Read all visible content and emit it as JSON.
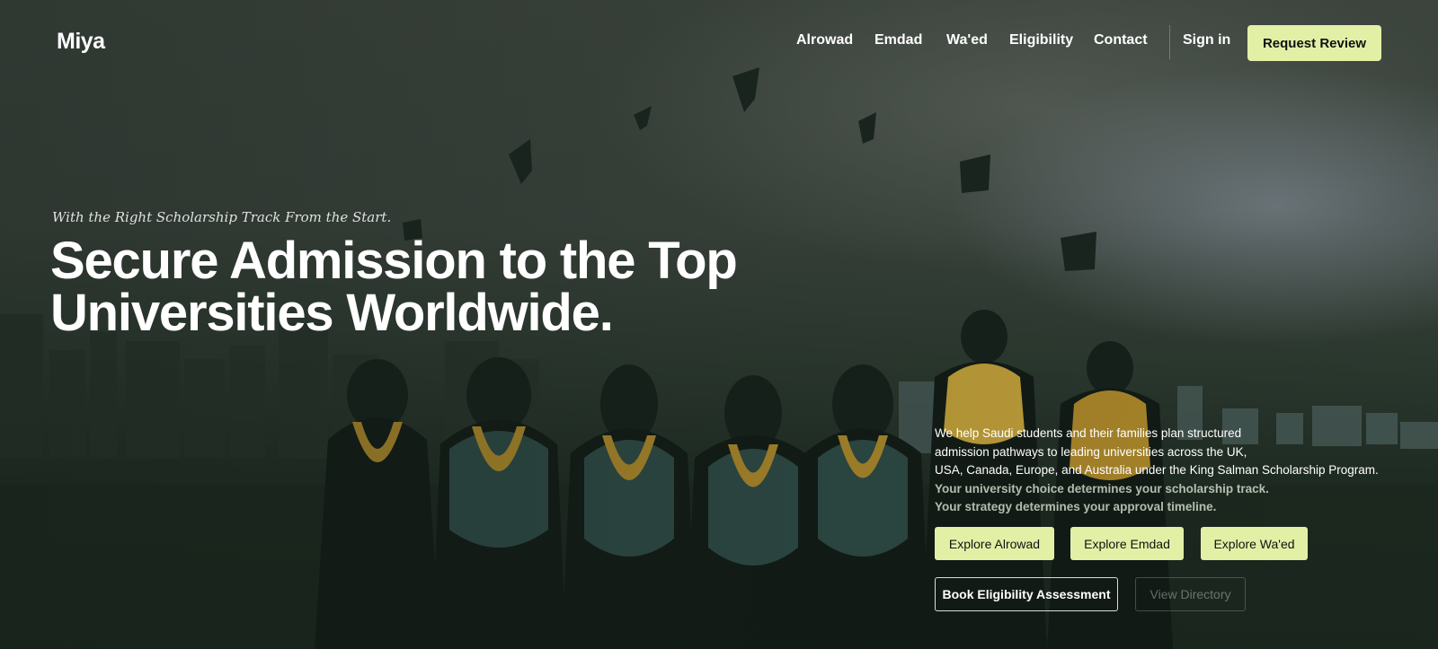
{
  "brand": {
    "logo_text": "Miya",
    "accent_color": "#e2f0a6"
  },
  "nav": {
    "items": [
      {
        "label": "Alrowad"
      },
      {
        "label": "Emdad"
      },
      {
        "label": "Wa'ed"
      },
      {
        "label": "Eligibility"
      },
      {
        "label": "Contact"
      }
    ],
    "sign_in_label": "Sign in",
    "cta_label": "Request Review"
  },
  "hero": {
    "background_image": "graduates-throwing-caps-photo",
    "tagline": "With the Right Scholarship Track From the Start.",
    "headline_line1": "Secure Admission to the Top",
    "headline_line2": "Universities Worldwide.",
    "description_lines": [
      "We help Saudi students and their families plan structured",
      "admission pathways to leading universities across the UK,",
      "USA, Canada, Europe, and Australia under the King Salman Scholarship Program."
    ],
    "emphasis_lines": [
      "Your university choice determines your scholarship track.",
      "Your strategy determines your approval timeline."
    ],
    "explore_buttons": [
      {
        "label": "Explore Alrowad"
      },
      {
        "label": "Explore Emdad"
      },
      {
        "label": "Explore Wa'ed"
      }
    ],
    "assessment_label": "Book Eligibility Assessment",
    "directory_label": "View Directory"
  }
}
